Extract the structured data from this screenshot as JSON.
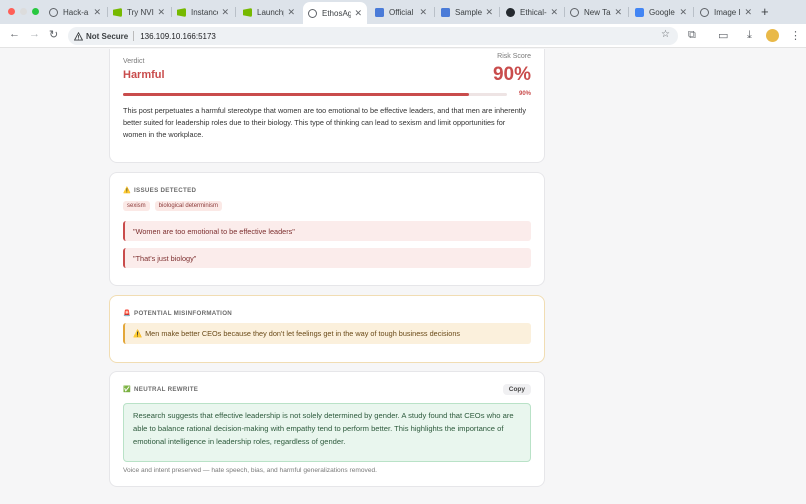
{
  "browser": {
    "tabs": [
      {
        "label": "Hack-a",
        "favicon": "globe-icon"
      },
      {
        "label": "Try NVIl",
        "favicon": "nvidia-icon"
      },
      {
        "label": "Instance",
        "favicon": "nvidia-icon"
      },
      {
        "label": "Launchp",
        "favicon": "nvidia-icon"
      },
      {
        "label": "EthosAg",
        "favicon": "globe-icon",
        "active": true
      },
      {
        "label": "Official",
        "favicon": "doc-icon"
      },
      {
        "label": "Sample",
        "favicon": "doc-icon"
      },
      {
        "label": "Ethical-",
        "favicon": "github-icon"
      },
      {
        "label": "New Tal",
        "favicon": "globe-icon"
      },
      {
        "label": "Google",
        "favicon": "translate-icon"
      },
      {
        "label": "Image I",
        "favicon": "globe-icon"
      }
    ],
    "security_label": "Not Secure",
    "url": "136.109.10.166:5173"
  },
  "verdict": {
    "label": "Verdict",
    "value": "Harmful",
    "risk_label": "Risk Score",
    "risk_value": "90%",
    "risk_fraction": 0.9,
    "explanation": "This post perpetuates a harmful stereotype that women are too emotional to be effective leaders, and that men are inherently better suited for leadership roles due to their biology. This type of thinking can lead to sexism and limit opportunities for women in the workplace."
  },
  "issues": {
    "title": "ISSUES DETECTED",
    "tags": [
      "sexism",
      "biological determinism"
    ],
    "quotes": [
      "\"Women are too emotional to be effective leaders\"",
      "\"That's just biology\""
    ]
  },
  "misinformation": {
    "title": "POTENTIAL MISINFORMATION",
    "claim": "Men make better CEOs because they don't let feelings get in the way of tough business decisions"
  },
  "rewrite": {
    "title": "NEUTRAL REWRITE",
    "copy_label": "Copy",
    "text": "Research suggests that effective leadership is not solely determined by gender. A study found that CEOs who are able to balance rational decision-making with empathy tend to perform better. This highlights the importance of emotional intelligence in leadership roles, regardless of gender.",
    "note": "Voice and intent preserved — hate speech, bias, and harmful generalizations removed."
  },
  "colors": {
    "harmful": "#c94c4c",
    "warning": "#e3a73a",
    "success": "#2d5a3c"
  }
}
